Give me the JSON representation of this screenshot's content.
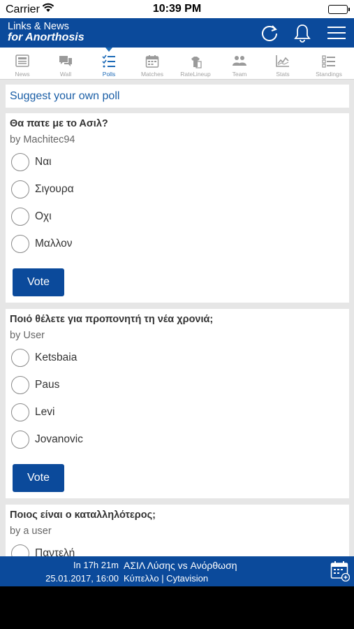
{
  "status_bar": {
    "carrier": "Carrier",
    "time": "10:39 PM"
  },
  "header": {
    "title_line1": "Links & News",
    "title_line2": "for Anorthosis"
  },
  "tabs": [
    {
      "label": "News",
      "icon": "news-icon",
      "active": false
    },
    {
      "label": "Wall",
      "icon": "wall-icon",
      "active": false
    },
    {
      "label": "Polls",
      "icon": "polls-icon",
      "active": true
    },
    {
      "label": "Matches",
      "icon": "calendar-icon",
      "active": false
    },
    {
      "label": "RateLineup",
      "icon": "lineup-icon",
      "active": false
    },
    {
      "label": "Team",
      "icon": "team-icon",
      "active": false
    },
    {
      "label": "Stats",
      "icon": "stats-icon",
      "active": false
    },
    {
      "label": "Standings",
      "icon": "standings-icon",
      "active": false
    }
  ],
  "suggest_link": "Suggest your own poll",
  "polls": [
    {
      "question": "Θα πατε με το Ασιλ?",
      "author": "by Machitec94",
      "options": [
        "Ναι",
        "Σιγουρα",
        "Οχι",
        "Μαλλον"
      ],
      "vote_label": "Vote"
    },
    {
      "question": "Ποιό θέλετε για προπονητή τη νέα χρονιά;",
      "author": "by User",
      "options": [
        "Ketsbaia",
        "Paus",
        "Levi",
        "Jovanovic"
      ],
      "vote_label": "Vote"
    },
    {
      "question": "Ποιος είναι ο καταλληλότερος;",
      "author": "by a user",
      "options": [
        "Παντελή"
      ],
      "vote_label": ""
    }
  ],
  "next_match": {
    "countdown": "In 17h 21m",
    "datetime": "25.01.2017, 16:00",
    "teams": "ΑΣΙΛ Λύσης vs Ανόρθωση",
    "competition": "Κύπελλο | Cytavision"
  },
  "colors": {
    "primary": "#0b4a9b",
    "active_tab": "#1c6ab7",
    "link": "#1a5ea6"
  }
}
